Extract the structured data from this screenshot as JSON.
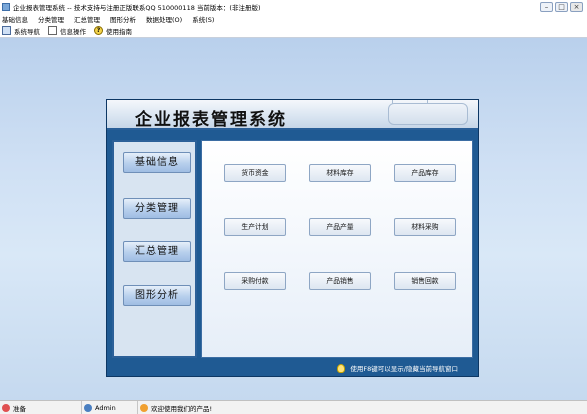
{
  "window": {
    "title": "企业报表管理系统 -- 技术支持与注册正版联系QQ 510000118   当前版本：(非注册版)",
    "minimize": "–",
    "maximize": "□",
    "close": "×"
  },
  "menu": [
    "基础信息",
    "分类管理",
    "汇总管理",
    "图形分析",
    "数据处理(O)",
    "系统(S)"
  ],
  "toolbar": {
    "nav_label": "系统导航",
    "info_label": "信息操作",
    "help_label": "使用指南",
    "help_glyph": "?"
  },
  "panel": {
    "title": "企业报表管理系统",
    "nav": [
      "基础信息",
      "分类管理",
      "汇总管理",
      "图形分析"
    ],
    "grid": [
      [
        "货币资金",
        "材料库存",
        "产品库存"
      ],
      [
        "生产计划",
        "产品产量",
        "材料采购"
      ],
      [
        "采购付款",
        "产品销售",
        "销售回款"
      ]
    ],
    "footer_tip": "使用F8键可以显示/隐藏当前导航窗口"
  },
  "status": {
    "ready": "准备",
    "user": "Admin",
    "welcome": "欢迎使用我们的产品!"
  },
  "colors": {
    "panel_blue": "#1f5a93",
    "workspace": "#cfe0f4"
  }
}
